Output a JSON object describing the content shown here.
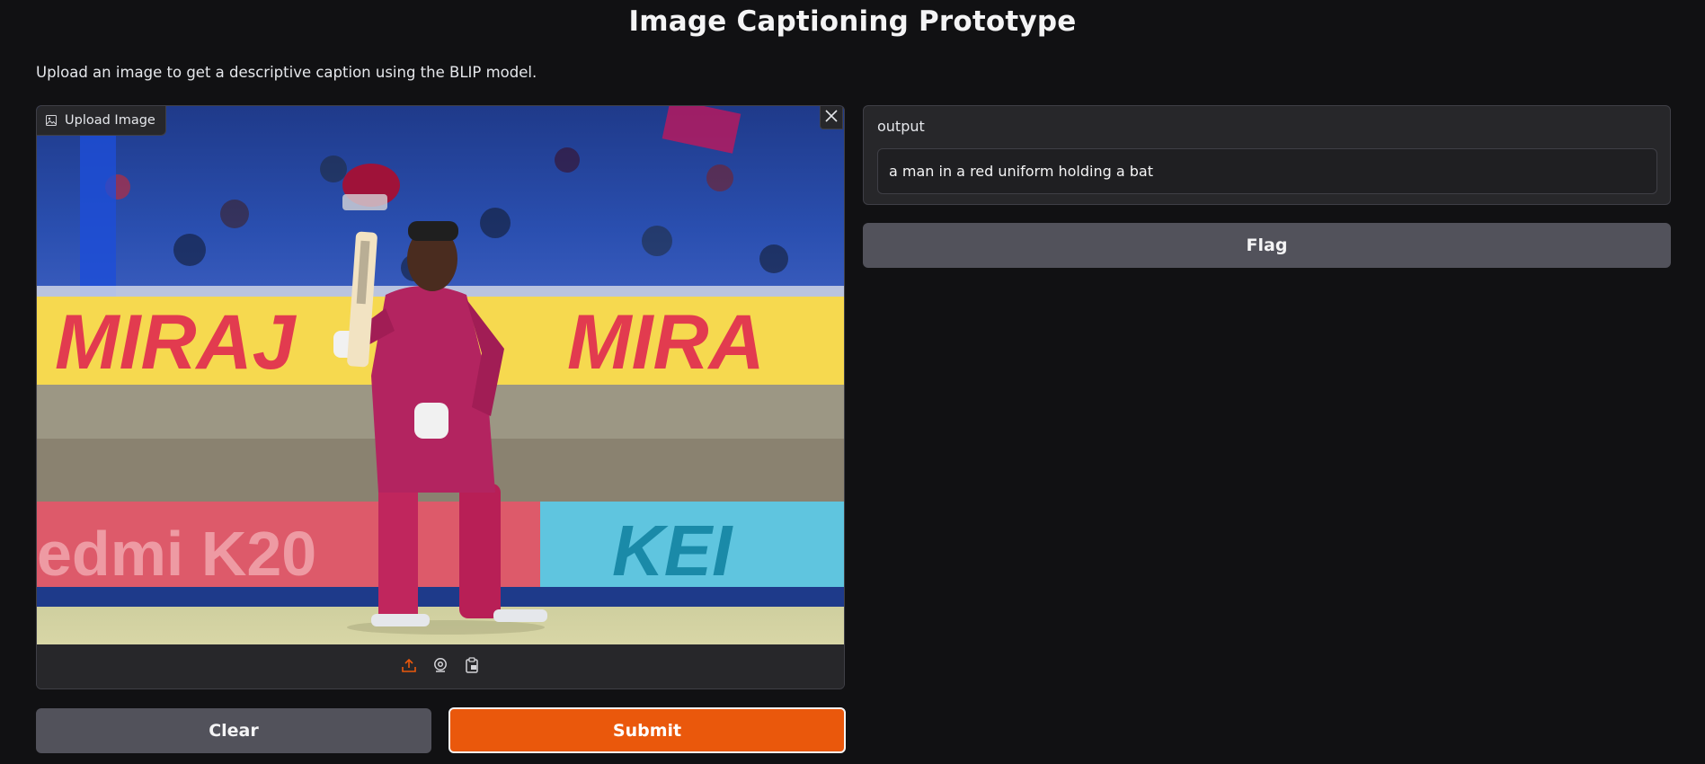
{
  "header": {
    "title": "Image Captioning Prototype",
    "description": "Upload an image to get a descriptive caption using the BLIP model."
  },
  "input": {
    "label": "Upload Image",
    "image_alt": "cricketer in maroon uniform holding a bat and helmet in a stadium",
    "source_icons": [
      "upload-icon",
      "webcam-icon",
      "clipboard-icon"
    ]
  },
  "output": {
    "label": "output",
    "value": "a man in a red uniform holding a bat"
  },
  "actions": {
    "clear_label": "Clear",
    "submit_label": "Submit",
    "flag_label": "Flag"
  },
  "colors": {
    "background": "#111113",
    "panel": "#27272a",
    "accent": "#ea580c",
    "secondary_button": "#52525b"
  }
}
